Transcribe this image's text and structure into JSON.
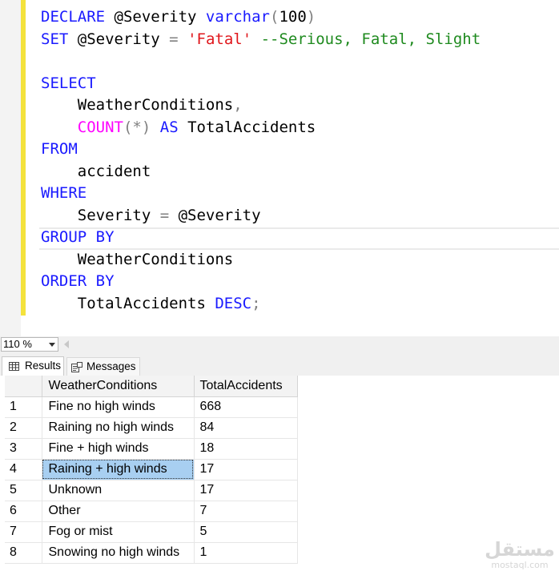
{
  "editor": {
    "lines": [
      [
        {
          "t": "DECLARE",
          "c": "kw"
        },
        {
          "t": " @Severity ",
          "c": ""
        },
        {
          "t": "varchar",
          "c": "kw"
        },
        {
          "t": "(",
          "c": "gray"
        },
        {
          "t": "100",
          "c": ""
        },
        {
          "t": ")",
          "c": "gray"
        }
      ],
      [
        {
          "t": "SET",
          "c": "kw"
        },
        {
          "t": " @Severity ",
          "c": ""
        },
        {
          "t": "=",
          "c": "gray"
        },
        {
          "t": " ",
          "c": ""
        },
        {
          "t": "'Fatal'",
          "c": "str"
        },
        {
          "t": " --Serious, Fatal, Slight",
          "c": "cmt"
        }
      ],
      [],
      [
        {
          "t": "SELECT",
          "c": "kw"
        }
      ],
      [
        {
          "t": "    WeatherConditions",
          "c": ""
        },
        {
          "t": ",",
          "c": "gray"
        }
      ],
      [
        {
          "t": "    ",
          "c": ""
        },
        {
          "t": "COUNT",
          "c": "fn"
        },
        {
          "t": "(*)",
          "c": "gray"
        },
        {
          "t": " ",
          "c": ""
        },
        {
          "t": "AS",
          "c": "kw"
        },
        {
          "t": " TotalAccidents",
          "c": ""
        }
      ],
      [
        {
          "t": "FROM",
          "c": "kw"
        }
      ],
      [
        {
          "t": "    accident",
          "c": ""
        }
      ],
      [
        {
          "t": "WHERE",
          "c": "kw"
        }
      ],
      [
        {
          "t": "    Severity ",
          "c": ""
        },
        {
          "t": "=",
          "c": "gray"
        },
        {
          "t": " @Severity",
          "c": ""
        }
      ],
      [
        {
          "t": "GROUP BY",
          "c": "kw"
        }
      ],
      [
        {
          "t": "    WeatherConditions",
          "c": ""
        }
      ],
      [
        {
          "t": "ORDER BY",
          "c": "kw"
        }
      ],
      [
        {
          "t": "    TotalAccidents ",
          "c": ""
        },
        {
          "t": "DESC",
          "c": "kw"
        },
        {
          "t": ";",
          "c": "gray"
        }
      ]
    ]
  },
  "zoom": {
    "value": "110 %"
  },
  "tabs": {
    "results": "Results",
    "messages": "Messages"
  },
  "grid": {
    "columns": [
      "WeatherConditions",
      "TotalAccidents"
    ],
    "selected_row": 4,
    "rows": [
      {
        "n": "1",
        "wc": "Fine no high winds",
        "ta": "668"
      },
      {
        "n": "2",
        "wc": "Raining no high winds",
        "ta": "84"
      },
      {
        "n": "3",
        "wc": "Fine + high winds",
        "ta": "18"
      },
      {
        "n": "4",
        "wc": "Raining + high winds",
        "ta": "17"
      },
      {
        "n": "5",
        "wc": "Unknown",
        "ta": "17"
      },
      {
        "n": "6",
        "wc": "Other",
        "ta": "7"
      },
      {
        "n": "7",
        "wc": "Fog or mist",
        "ta": "5"
      },
      {
        "n": "8",
        "wc": "Snowing no high winds",
        "ta": "1"
      }
    ]
  },
  "watermark": {
    "arabic": "مستقل",
    "latin": "mostaql.com"
  }
}
